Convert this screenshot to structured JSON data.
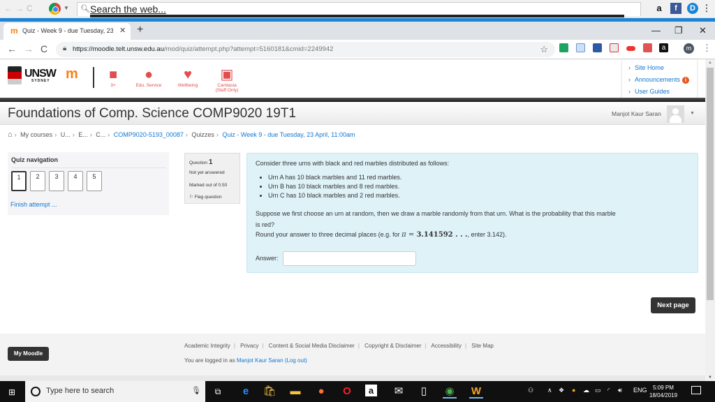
{
  "topbar": {
    "search_placeholder": "Search the web...",
    "extensions": [
      "amazon-icon",
      "facebook-icon",
      "dashlane-icon"
    ]
  },
  "browser": {
    "tab_title": "Quiz - Week 9 - due Tuesday, 23",
    "url_host": "https://moodle.telt.unsw.edu.au",
    "url_path": "/mod/quiz/attempt.php?attempt=5160181&cmid=2249942",
    "avatar_letter": "m"
  },
  "site_header": {
    "logo_text": "UNSW",
    "logo_sub": "SYDNEY",
    "icons": [
      {
        "name": "3plus",
        "label": "3+"
      },
      {
        "name": "edu-service",
        "label": "Edu. Service"
      },
      {
        "name": "wellbeing",
        "label": "Wellbeing"
      },
      {
        "name": "camtasia",
        "label": "Camtasia (Staff Only)"
      }
    ],
    "menu": [
      "Site Home",
      "Announcements",
      "User Guides"
    ]
  },
  "page_header": {
    "title": "Foundations of Comp. Science COMP9020 19T1",
    "user_name": "Manjot Kaur Saran"
  },
  "breadcrumb": [
    "My courses",
    "U...",
    "E...",
    "C...",
    "COMP9020-5193_00087",
    "Quizzes",
    "Quiz - Week 9 - due Tuesday, 23 April, 11:00am"
  ],
  "quiz_nav": {
    "title": "Quiz navigation",
    "questions": [
      "1",
      "2",
      "3",
      "4",
      "5"
    ],
    "current": "1",
    "finish_label": "Finish attempt ..."
  },
  "question": {
    "label": "Question",
    "number": "1",
    "state": "Not yet answered",
    "marks": "Marked out of 0.50",
    "flag_label": "Flag question",
    "intro": "Consider three urns with black and red marbles distributed as follows:",
    "bullets": [
      "Urn A has 10 black marbles and 11 red marbles.",
      "Urn B has 10 black marbles and 8 red marbles.",
      "Urn C has 10 black marbles and 2 red marbles."
    ],
    "prompt_line1": "Suppose we first choose an urn at random, then we draw a marble randomly from that urn. What is the probability that this marble",
    "prompt_line2": "is red?",
    "round_prefix": "Round your answer to three decimal places (e.g. for ",
    "round_pi": "π",
    "round_eq": " = ",
    "round_value": "3.141592 . . .",
    "round_suffix": ", enter 3.142).",
    "answer_label": "Answer:",
    "answer_value": ""
  },
  "next_page_label": "Next page",
  "footer": {
    "my_moodle": "My Moodle",
    "links": [
      "Academic Integrity",
      "Privacy",
      "Content & Social Media Disclaimer",
      "Copyright & Disclaimer",
      "Accessibility",
      "Site Map"
    ],
    "logged_in_prefix": "You are logged in as ",
    "logged_in_user": "Manjot Kaur Saran",
    "logout": "(Log out)"
  },
  "taskbar": {
    "search_placeholder": "Type here to search",
    "language": "ENG",
    "time": "5:09 PM",
    "date": "18/04/2019"
  }
}
